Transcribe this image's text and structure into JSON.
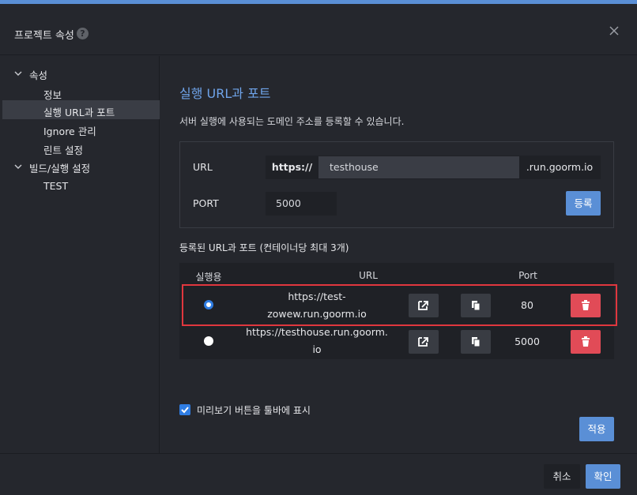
{
  "dialog": {
    "title": "프로젝트 속성",
    "help_glyph": "?"
  },
  "sidebar": {
    "groups": [
      {
        "label": "속성",
        "items": [
          "정보",
          "실행 URL과 포트",
          "Ignore 관리",
          "린트 설정"
        ]
      },
      {
        "label": "빌드/실행 설정",
        "items": [
          "TEST"
        ]
      }
    ],
    "active_item": "실행 URL과 포트"
  },
  "main": {
    "title": "실행 URL과 포트",
    "description": "서버 실행에 사용되는 도메인 주소를 등록할 수 있습니다.",
    "form": {
      "url_label": "URL",
      "url_prefix": "https://",
      "url_value": "testhouse",
      "url_suffix": ".run.goorm.io",
      "port_label": "PORT",
      "port_value": "5000",
      "register_button": "등록"
    },
    "list_title": "등록된 URL과 포트 (컨테이너당 최대 3개)",
    "table": {
      "headers": {
        "active": "실행용",
        "url": "URL",
        "port": "Port"
      },
      "rows": [
        {
          "url_line1": "https://test-",
          "url_line2": "zowew.run.goorm.io",
          "port": "80",
          "selected": true
        },
        {
          "url_line1": "https://testhouse.run.goorm.",
          "url_line2": "io",
          "port": "5000",
          "selected": false
        }
      ]
    },
    "preview_checkbox": {
      "label": "미리보기 버튼을 툴바에 표시",
      "checked": true
    },
    "apply_button": "적용"
  },
  "footer": {
    "cancel_button": "취소",
    "confirm_button": "확인"
  },
  "colors": {
    "accent": "#5a8fd6",
    "title_blue": "#6fa4ea",
    "danger": "#e14b57",
    "highlight_border": "#e0373e"
  }
}
